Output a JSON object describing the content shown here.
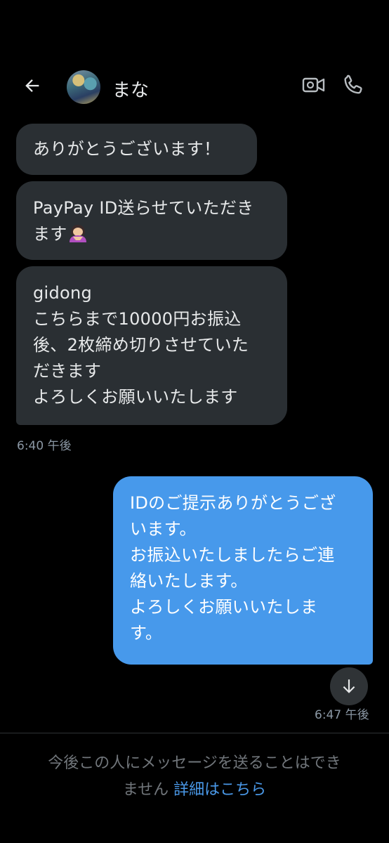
{
  "header": {
    "contact_name": "まな",
    "icons": [
      "back-arrow-icon",
      "avatar",
      "video-camera-icon",
      "phone-icon"
    ]
  },
  "messages": [
    {
      "side": "in",
      "lines": [
        "ありがとうございます！"
      ]
    },
    {
      "side": "in",
      "lines": [
        "PayPay ID送らせていただき",
        "ます"
      ],
      "emoji": "woman-bowing-emoji"
    },
    {
      "side": "in",
      "lines": [
        "gidong",
        "こちらまで10000円お振込",
        "後、2枚締め切りさせていた",
        "だきます",
        "よろしくお願いいたします"
      ]
    },
    {
      "side": "out",
      "lines": [
        "IDのご提示ありがとうござ",
        "います。",
        "お振込いたしましたらご連",
        "絡いたします。",
        "よろしくお願いいたしま",
        "す。"
      ]
    }
  ],
  "timestamps": {
    "incoming": "6:40 午後",
    "outgoing": "6:47 午後"
  },
  "footer": {
    "line1": "今後この人にメッセージを送ることはでき",
    "line2_text": "ません",
    "link": "詳細はこちら"
  },
  "colors": {
    "background": "#000000",
    "incoming_bubble": "#2a2f33",
    "outgoing_bubble": "#4799eb",
    "link": "#4a99e9",
    "muted_text": "#8b98a5"
  }
}
